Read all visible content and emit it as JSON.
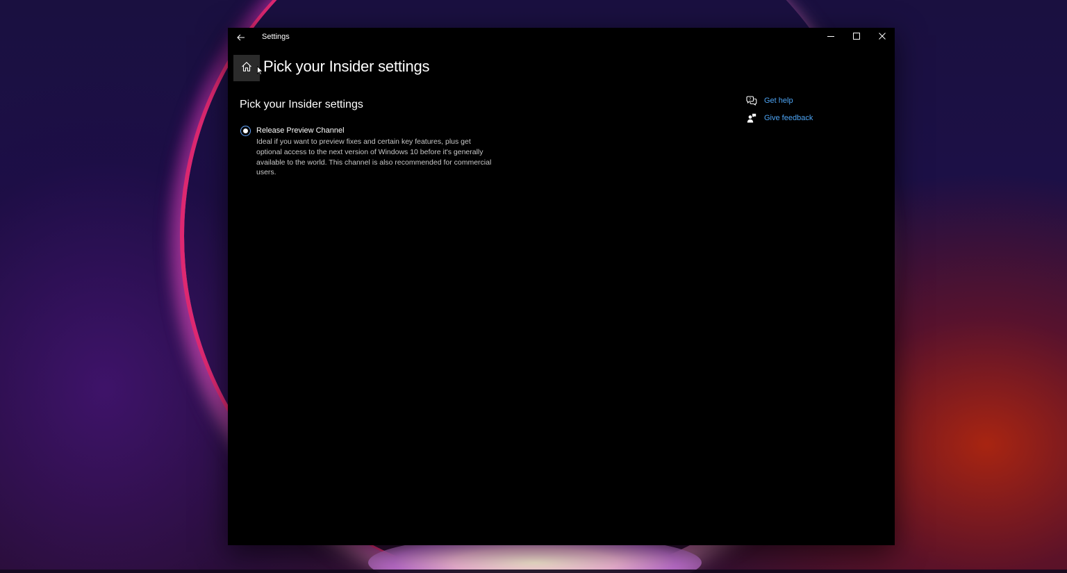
{
  "window": {
    "title": "Settings"
  },
  "page": {
    "title": "Pick your Insider settings",
    "section_title": "Pick your Insider settings"
  },
  "option": {
    "label": "Release Preview Channel",
    "description": "Ideal if you want to preview fixes and certain key features, plus get optional access to the next version of Windows 10 before it's generally available to the world. This channel is also recommended for commercial users.",
    "selected": true
  },
  "help": {
    "get_help": "Get help",
    "give_feedback": "Give feedback"
  },
  "icons": {
    "back": "back-arrow-icon",
    "home": "home-icon",
    "minimize": "minimize-icon",
    "maximize": "maximize-icon",
    "close": "close-icon",
    "get_help": "chat-help-icon",
    "give_feedback": "feedback-person-icon"
  },
  "colors": {
    "accent": "#66a8ff",
    "link": "#4ea5f5",
    "window_bg": "#000000"
  }
}
